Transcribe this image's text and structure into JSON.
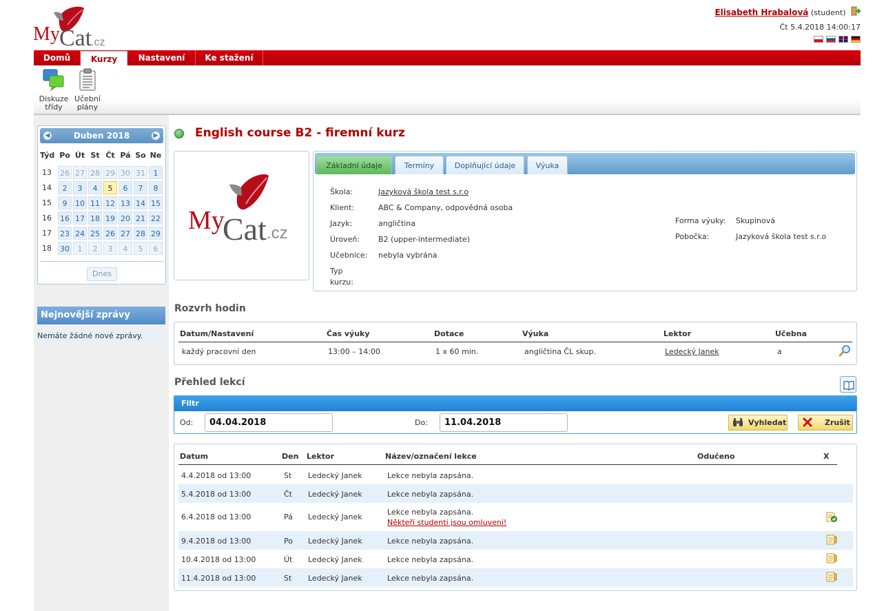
{
  "header": {
    "user_name": "Elisabeth Hrabalová",
    "user_role": "(student)",
    "datetime": "Čt 5.4.2018 14:00:17",
    "flags": [
      "cz-flag",
      "sk-flag",
      "uk-flag",
      "de-flag"
    ]
  },
  "logo": {
    "text_my": "My",
    "text_cat": "Cat",
    "text_cz": ".cz"
  },
  "nav": {
    "tabs": [
      {
        "label": "Domů",
        "active": false
      },
      {
        "label": "Kurzy",
        "active": true
      },
      {
        "label": "Nastavení",
        "active": false
      },
      {
        "label": "Ke stažení",
        "active": false
      }
    ]
  },
  "toolbar": {
    "items": [
      {
        "label_line1": "Diskuze",
        "label_line2": "třídy",
        "icon": "discussion-icon"
      },
      {
        "label_line1": "Učební",
        "label_line2": "plány",
        "icon": "clipboard-icon"
      }
    ]
  },
  "calendar": {
    "month_label": "Duben 2018",
    "headers": [
      "Týd",
      "Po",
      "Út",
      "St",
      "Čt",
      "Pá",
      "So",
      "Ne"
    ],
    "weeks": [
      {
        "week": "13",
        "days": [
          "26",
          "27",
          "28",
          "29",
          "30",
          "31",
          "1"
        ],
        "other": [
          true,
          true,
          true,
          true,
          true,
          true,
          false
        ]
      },
      {
        "week": "14",
        "days": [
          "2",
          "3",
          "4",
          "5",
          "6",
          "7",
          "8"
        ],
        "other": [
          false,
          false,
          false,
          false,
          false,
          false,
          false
        ]
      },
      {
        "week": "15",
        "days": [
          "9",
          "10",
          "11",
          "12",
          "13",
          "14",
          "15"
        ],
        "other": [
          false,
          false,
          false,
          false,
          false,
          false,
          false
        ]
      },
      {
        "week": "16",
        "days": [
          "16",
          "17",
          "18",
          "19",
          "20",
          "21",
          "22"
        ],
        "other": [
          false,
          false,
          false,
          false,
          false,
          false,
          false
        ]
      },
      {
        "week": "17",
        "days": [
          "23",
          "24",
          "25",
          "26",
          "27",
          "28",
          "29"
        ],
        "other": [
          false,
          false,
          false,
          false,
          false,
          false,
          false
        ]
      },
      {
        "week": "18",
        "days": [
          "30",
          "1",
          "2",
          "3",
          "4",
          "5",
          "6"
        ],
        "other": [
          false,
          true,
          true,
          true,
          true,
          true,
          true
        ]
      }
    ],
    "today_day": "5",
    "today_button": "Dnes"
  },
  "news": {
    "title": "Nejnovější zprávy",
    "empty_text": "Nemáte žádné nové zprávy."
  },
  "course": {
    "title": "English course B2 - firemní kurz",
    "status_color": "#2d9b2d"
  },
  "info_tabs": [
    {
      "label": "Základní údaje",
      "active": true
    },
    {
      "label": "Termíny",
      "active": false
    },
    {
      "label": "Doplňující údaje",
      "active": false
    },
    {
      "label": "Výuka",
      "active": false
    }
  ],
  "info": {
    "left": [
      {
        "label": "Škola:",
        "value": "Jazyková škola test s.r.o",
        "link": true
      },
      {
        "label": "Klient:",
        "value": "ABC & Company, odpovědná osoba",
        "link": false
      },
      {
        "label": "Jazyk:",
        "value": "angličtina",
        "link": false
      },
      {
        "label": "Úroveň:",
        "value": "B2 (upper-intermediate)",
        "link": false
      },
      {
        "label": "Učebnice:",
        "value": "nebyla vybrána",
        "link": false
      },
      {
        "label": "Typ kurzu:",
        "value": "",
        "link": false
      }
    ],
    "right": [
      {
        "label": "Forma výuky:",
        "value": "Skupinová"
      },
      {
        "label": "Pobočka:",
        "value": "Jazyková škola test s.r.o"
      }
    ]
  },
  "schedule": {
    "title": "Rozvrh hodin",
    "headers": [
      "Datum/Nastavení",
      "Čas výuky",
      "Dotace",
      "Výuka",
      "Lektor",
      "Učebna"
    ],
    "row": [
      "každý pracovní den",
      "13:00 – 14:00",
      "1 x 60 min.",
      "angličtina ČL skup.",
      "Ledecký Janek",
      "a"
    ]
  },
  "lessons_overview": {
    "title": "Přehled lekcí",
    "filter": {
      "title": "Filtr",
      "from_label": "Od:",
      "from_value": "04.04.2018",
      "to_label": "Do:",
      "to_value": "11.04.2018",
      "search_label": "Vyhledat",
      "cancel_label": "Zrušit"
    },
    "headers": [
      "Datum",
      "Den",
      "Lektor",
      "Název/označení lekce",
      "Odučeno",
      "X"
    ],
    "rows": [
      {
        "date": "4.4.2018 od 13:00",
        "day": "St",
        "lector": "Ledecký Janek",
        "name": "Lekce nebyla zapsána.",
        "note": "",
        "icon": ""
      },
      {
        "date": "5.4.2018 od 13:00",
        "day": "Čt",
        "lector": "Ledecký Janek",
        "name": "Lekce nebyla zapsána.",
        "note": "",
        "icon": ""
      },
      {
        "date": "6.4.2018 od 13:00",
        "day": "Pá",
        "lector": "Ledecký Janek",
        "name": "Lekce nebyla zapsána.",
        "note": "Někteří studenti jsou omluveni!",
        "icon": "book-check-icon"
      },
      {
        "date": "9.4.2018 od 13:00",
        "day": "Po",
        "lector": "Ledecký Janek",
        "name": "Lekce nebyla zapsána.",
        "note": "",
        "icon": "book-excuse-icon"
      },
      {
        "date": "10.4.2018 od 13:00",
        "day": "Út",
        "lector": "Ledecký Janek",
        "name": "Lekce nebyla zapsána.",
        "note": "",
        "icon": "book-excuse-icon"
      },
      {
        "date": "11.4.2018 od 13:00",
        "day": "St",
        "lector": "Ledecký Janek",
        "name": "Lekce nebyla zapsána.",
        "note": "",
        "icon": "book-excuse-icon"
      }
    ]
  }
}
